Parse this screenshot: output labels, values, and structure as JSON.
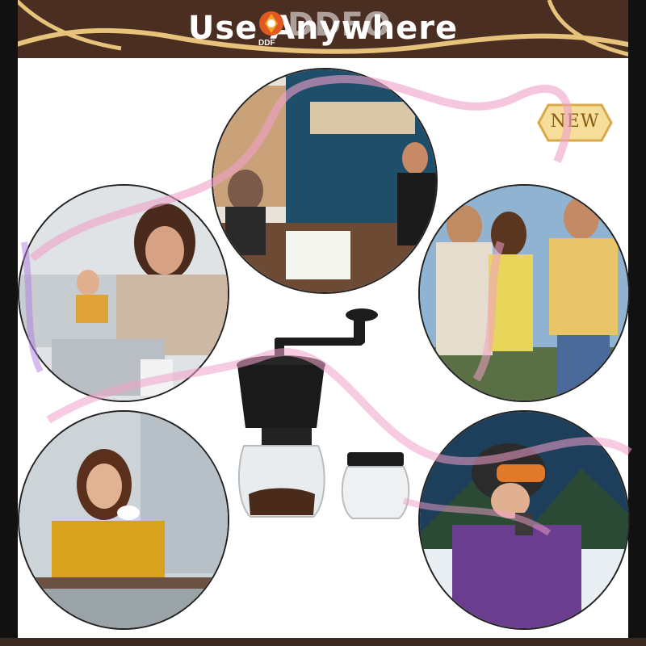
{
  "banner": {
    "title": "Use Anywhere",
    "brand_name": "DDFO",
    "brand_sub": "DDF"
  },
  "badge": {
    "label": "NEW"
  },
  "colors": {
    "banner_bg": "#4a2e22",
    "frame": "#111111",
    "ribbon": "#f0a0c8",
    "gold": "#e6c27a"
  },
  "photos": [
    {
      "name": "photo-bar-scene"
    },
    {
      "name": "photo-woman-laptop"
    },
    {
      "name": "photo-barbecue-friends"
    },
    {
      "name": "photo-woman-coffee"
    },
    {
      "name": "photo-skier-drinking"
    }
  ],
  "product": {
    "name": "manual-coffee-grinder"
  }
}
